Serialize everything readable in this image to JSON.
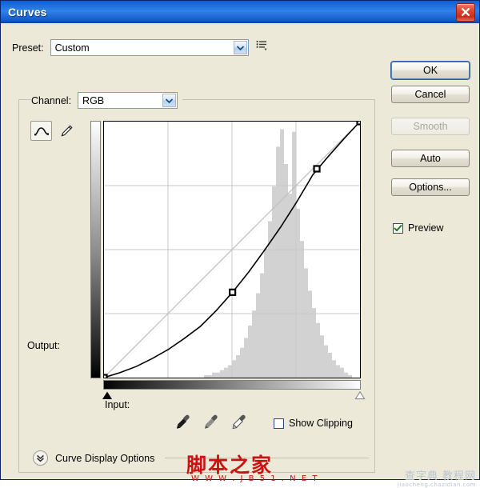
{
  "window": {
    "title": "Curves",
    "close_icon": "close-x-icon",
    "accent_titlebar": "#1464da",
    "close_button_color": "#c52d18"
  },
  "preset": {
    "label": "Preset:",
    "value": "Custom",
    "arrow_icon": "chevron-down-icon",
    "menu_icon": "preset-list-menu-icon"
  },
  "channel": {
    "label": "Channel:",
    "value": "RGB",
    "arrow_icon": "chevron-down-icon"
  },
  "tools": {
    "curve_tool_icon": "curve-pencil-tool-icon",
    "pencil_tool_icon": "pencil-tool-icon",
    "selected": "curve_tool"
  },
  "graph": {
    "output_label": "Output:",
    "input_label": "Input:",
    "vertical_gradient": "white-to-black",
    "horizontal_gradient": "black-to-white",
    "black_point_slider_icon": "filled-triangle-slider",
    "white_point_slider_icon": "hollow-triangle-slider"
  },
  "eyedroppers": [
    {
      "name": "black-point-eyedropper",
      "icon": "eyedropper-icon"
    },
    {
      "name": "gray-point-eyedropper",
      "icon": "eyedropper-icon"
    },
    {
      "name": "white-point-eyedropper",
      "icon": "eyedropper-icon"
    }
  ],
  "show_clipping": {
    "label": "Show Clipping",
    "checked": false
  },
  "preview": {
    "label": "Preview",
    "checked": true,
    "check_color": "#1a7a1a"
  },
  "curve_display_options": {
    "label": "Curve Display Options",
    "expand_icon": "double-chevron-down-icon",
    "expanded": false
  },
  "buttons": {
    "ok": "OK",
    "cancel": "Cancel",
    "smooth": "Smooth",
    "auto": "Auto",
    "options": "Options..."
  },
  "watermark": {
    "main": "脚本之家",
    "sub": "W W W . J B 5 1 . N E T",
    "corner": "查字典 教程网",
    "corner_sub": "jiaocheng.chazidian.com"
  },
  "chart_data": {
    "type": "line",
    "title": "Curves tone curve",
    "xlabel": "Input",
    "ylabel": "Output",
    "xlim": [
      0,
      255
    ],
    "ylim": [
      0,
      255
    ],
    "grid": true,
    "grid_divisions": 4,
    "legend": "none",
    "series": [
      {
        "name": "baseline-diagonal",
        "color": "#bfbfbf",
        "points": [
          [
            0,
            0
          ],
          [
            255,
            255
          ]
        ]
      },
      {
        "name": "tone-curve",
        "color": "#000000",
        "control_points": [
          [
            0,
            0
          ],
          [
            128,
            85
          ],
          [
            212,
            208
          ],
          [
            255,
            255
          ]
        ],
        "points": [
          [
            0,
            0
          ],
          [
            16,
            5
          ],
          [
            32,
            11
          ],
          [
            48,
            19
          ],
          [
            64,
            28
          ],
          [
            80,
            39
          ],
          [
            96,
            51
          ],
          [
            112,
            67
          ],
          [
            128,
            85
          ],
          [
            144,
            105
          ],
          [
            160,
            127
          ],
          [
            176,
            150
          ],
          [
            192,
            175
          ],
          [
            208,
            202
          ],
          [
            224,
            221
          ],
          [
            240,
            239
          ],
          [
            255,
            255
          ]
        ]
      }
    ],
    "histogram": {
      "name": "rgb-histogram",
      "color": "#d2d2d2",
      "bins": 64,
      "values": [
        0.0,
        0.0,
        0.0,
        0.0,
        0.0,
        0.0,
        0.0,
        0.0,
        0.0,
        0.0,
        0.0,
        0.0,
        0.0,
        0.0,
        0.0,
        0.0,
        0.0,
        0.0,
        0.0,
        0.0,
        0.0,
        0.0,
        0.0,
        0.0,
        0.0,
        0.01,
        0.01,
        0.02,
        0.02,
        0.03,
        0.04,
        0.05,
        0.07,
        0.09,
        0.12,
        0.16,
        0.21,
        0.27,
        0.34,
        0.42,
        0.52,
        0.63,
        0.77,
        0.93,
        1.0,
        0.86,
        0.74,
        0.99,
        0.68,
        0.55,
        0.44,
        0.35,
        0.28,
        0.22,
        0.17,
        0.13,
        0.1,
        0.07,
        0.05,
        0.04,
        0.02,
        0.01,
        0.0,
        0.0
      ]
    }
  }
}
